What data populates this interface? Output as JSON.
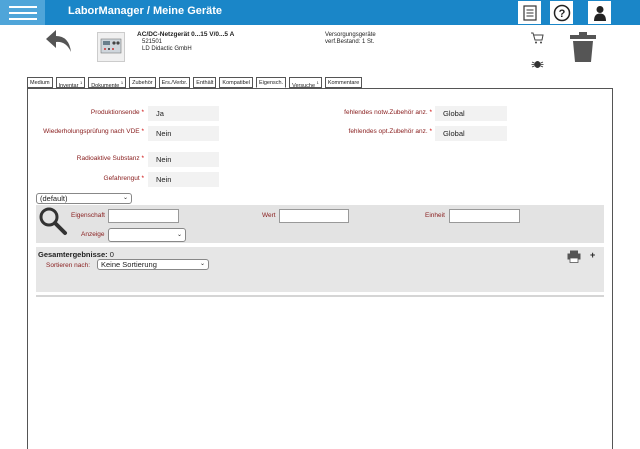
{
  "header": {
    "title": "LaborManager / Meine Geräte"
  },
  "device": {
    "name": "AC/DC-Netzgerät 0...15 V/0...5 A",
    "number": "521501",
    "manufacturer": "LD Didactic GmbH",
    "category": "Versorgungsgeräte",
    "stock": "verf.Bestand: 1 St."
  },
  "tabs": [
    {
      "label": "Medium",
      "badge": ""
    },
    {
      "label": "Inventar",
      "badge": "1"
    },
    {
      "label": "Dokumente",
      "badge": "1"
    },
    {
      "label": "Zubehör",
      "badge": ""
    },
    {
      "label": "Ers./Verbr.",
      "badge": ""
    },
    {
      "label": "Enthält",
      "badge": ""
    },
    {
      "label": "Kompatibel",
      "badge": ""
    },
    {
      "label": "Eigensch.",
      "badge": ""
    },
    {
      "label": "Versuche",
      "badge": "1"
    },
    {
      "label": "Kommentare",
      "badge": ""
    }
  ],
  "fields_left": [
    {
      "label": "Produktionsende",
      "value": "Ja"
    },
    {
      "label": "Wiederholungsprüfung nach VDE",
      "value": "Nein"
    },
    {
      "label": "Radioaktive Substanz",
      "value": "Nein"
    },
    {
      "label": "Gefahrengut",
      "value": "Nein"
    }
  ],
  "fields_right": [
    {
      "label": "fehlendes notw.Zubehör anz.",
      "value": "Global"
    },
    {
      "label": "fehlendes opt.Zubehör anz.",
      "value": "Global"
    }
  ],
  "required_marker": "*",
  "preset_select": "(default)",
  "filter": {
    "property_label": "Eigenschaft",
    "value_label": "Wert",
    "unit_label": "Einheit",
    "display_label": "Anzeige",
    "display_value": ""
  },
  "results": {
    "total_label": "Gesamtergebnisse:",
    "total_count": "0",
    "sort_label": "Sortieren nach:",
    "sort_value": "Keine Sortierung",
    "add_label": "+"
  },
  "colors": {
    "topbar": "#1a86c8",
    "label": "#8a2020",
    "required": "#c00000"
  }
}
